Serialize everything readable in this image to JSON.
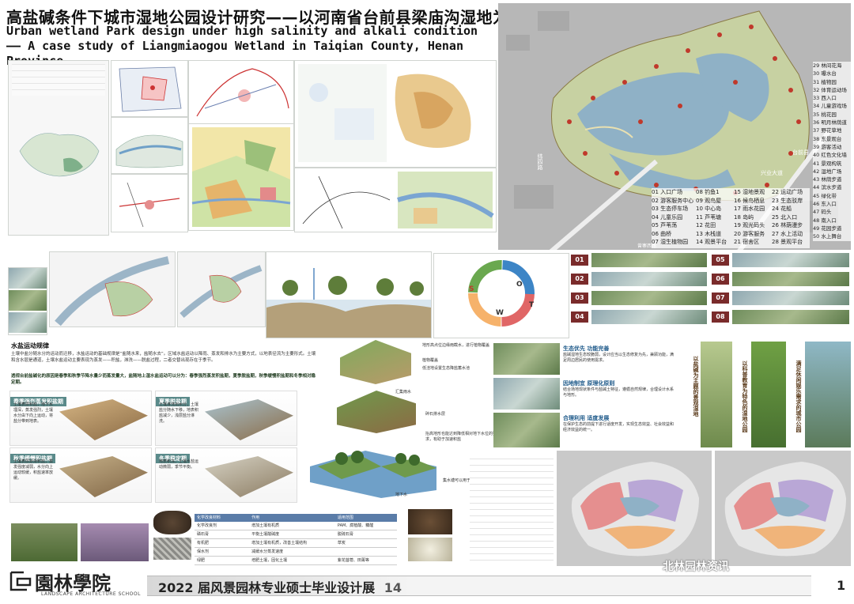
{
  "header": {
    "title_cn": "高盐碱条件下城市湿地公园设计研究——以河南省台前县梁庙沟湿地为例",
    "title_en": "Urban wetland Park design under high salinity and alkali condition—— A case study of Liangmiaogou Wetland in Taiqian County, Henan Province"
  },
  "site_plan": {
    "legend": [
      "01 入口广场",
      "02 游客服务中心",
      "03 生态停车场",
      "04 儿童乐园",
      "05 芦苇荡",
      "06 曲桥",
      "07 湿生植物园",
      "08 钓鱼1",
      "09 观鸟屋",
      "10 中心岛",
      "11 芦苇塘",
      "12 花田",
      "13 木栈道",
      "14 观景平台",
      "15 湿地景观",
      "16 候鸟栖息",
      "17 雨水花园",
      "18 岛屿",
      "19 观光码头",
      "20 游客服务",
      "21 宿舍区",
      "22 运动广场",
      "23 生态驳岸",
      "24 花船",
      "25 北入口",
      "26 林荫漫步",
      "27 水上活动",
      "28 景观平台",
      "29 林间花海",
      "30 曝水台",
      "31 植物园",
      "32 体育运动场",
      "33 西入口",
      "34 儿童游戏场",
      "35 桃花园",
      "36 明月林荫道",
      "37 野花草地",
      "38 东景观台",
      "39 游客活动",
      "40 红色文化墙",
      "41 景观构筑",
      "42 湿地广场",
      "43 林荫步道",
      "44 滨水步道",
      "45 绿化带",
      "46 东入口",
      "47 码头",
      "48 南入口",
      "49 花园步道",
      "50 水上舞台"
    ],
    "road_labels": [
      "纬四路",
      "兴业大道",
      "台前县",
      "曾寨西路"
    ]
  },
  "sections": {
    "water_movement_title": "水盐运动规律",
    "water_movement_text": "土壤中盐分随水分的运动而迁移，水盐运动的基础规律是“盐随水来，盐随水去”。区域水盐运动以降雨、蒸发和排水为主要方式，以地表径流为主要形式。土壤和含水层是通道，土壤水盐运动主要表现为蒸发——积盐，淋洗——脱盐过程，二者交替出现存在于季节。",
    "salt_accumulation_text": "透视台前盐碱化的原因是春季和秋季节降水量少而蒸发量大，盐随地上湿水盐运动可以分为：春季强烈蒸发积盐期，夏季脱盐期，秋季缓慢积盐期和冬季相对稳定期。",
    "seasons": [
      {
        "label": "春季强烈蒸发积盐期",
        "text": "土壤表层积盐，地下水埋深，蒸发强烈，土壤水分由下向上运动，将盐分带到地表。"
      },
      {
        "label": "夏季脱盐期",
        "text": "土壤淋洗出水分，土壤盐分随水下移，地表积盐减少，浅层盐分淋洗。"
      },
      {
        "label": "秋季缓慢积盐期",
        "text": "土壤表层逐渐积盐，蒸发强度减弱，水分向上运动较缓，积盐速率放缓。"
      },
      {
        "label": "冬季稳定期",
        "text": "地表积冻，土壤水盐运动微弱，季节平衡。"
      }
    ],
    "diagram_labels": [
      "地形高点位边缘雨截水，进行植物覆盖",
      "植物覆盖",
      "低洼地设置生态降盐蓄水池",
      "汇集雨水",
      "碎石排水层",
      "抬高地形也能达到降低相对地下水位的要求，有助于加速积盐",
      "集水塘可以用于收集雨水",
      "地下水"
    ]
  },
  "strategies": {
    "items": [
      {
        "title": "生态优先 功能完善",
        "text": "盐碱湿地生态较脆弱，设计应当以生态修复为先，兼顾功能，满足周边居民的使用需求。"
      },
      {
        "title": "因地制宜 原理化原则",
        "text": "结合场地现状条件与盐碱土特征，遵循自然规律，合理设计水系与地形。"
      },
      {
        "title": "合理利用 适度发展",
        "text": "在保护生态的前提下进行适度开发，实现生态效益、社会效益和经济效益的统一。"
      }
    ],
    "vertical_labels": [
      "以盐碱为主题的景观湿地",
      "以科普教育为特色的湿地公园",
      "满足休闲娱乐需求的城市公园"
    ]
  },
  "stage_tags": [
    "01",
    "02",
    "03",
    "04",
    "05",
    "06",
    "07",
    "08"
  ],
  "soil_table": {
    "headers": [
      "化学改良材料",
      "作用",
      "适用范围"
    ],
    "rows": [
      [
        "化学改良剂",
        "增加土壤有机质",
        "PAM、腐植酸、糠醛"
      ],
      [
        "磷石膏",
        "平衡土壤酸碱度",
        "脱硫石膏"
      ],
      [
        "有机肥",
        "增加土壤有机质，改善土壤结构",
        "草炭"
      ],
      [
        "保水剂",
        "减缓水分蒸发速度",
        ""
      ],
      [
        "绿肥",
        "培肥土壤，固化土壤",
        "紫花苜蓿、田菁等"
      ]
    ]
  },
  "swot_letters": [
    "S",
    "W",
    "O",
    "T"
  ],
  "footer": {
    "logo": "園林學院",
    "logo_sub": "LANDSCAPE ARCHITECTURE SCHOOL",
    "exhibition": "2022 届风景园林专业硕士毕业设计展",
    "exhibition_num": "14",
    "page": "1",
    "watermark": "北林园林资讯"
  }
}
